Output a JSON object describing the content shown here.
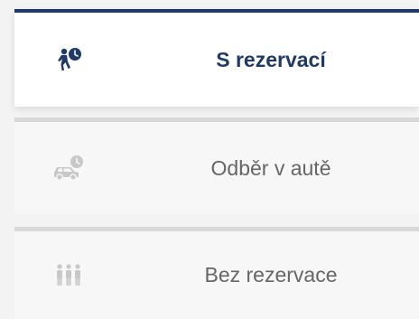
{
  "tabs": [
    {
      "label": "S rezervací",
      "icon": "walking-person-clock-icon",
      "active": true
    },
    {
      "label": "Odběr v autě",
      "icon": "car-clock-icon",
      "active": false
    },
    {
      "label": "Bez rezervace",
      "icon": "group-people-icon",
      "active": false
    }
  ],
  "colors": {
    "active": "#1f3a66",
    "inactive_text": "#666666",
    "inactive_icon": "#c8c8c8",
    "inactive_border": "#d8d8d8"
  }
}
